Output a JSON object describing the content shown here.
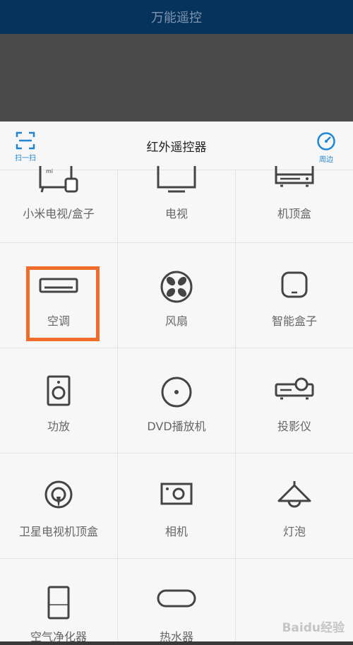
{
  "app": {
    "title": "万能遥控"
  },
  "sheet": {
    "title": "红外遥控器",
    "scan_label": "扫一扫",
    "nearby_label": "周边"
  },
  "devices": {
    "row0": [
      "小米电视/盒子",
      "电视",
      "机顶盒"
    ],
    "row1": [
      "空调",
      "风扇",
      "智能盒子"
    ],
    "row2": [
      "功放",
      "DVD播放机",
      "投影仪"
    ],
    "row3": [
      "卫星电视机顶盒",
      "相机",
      "灯泡"
    ],
    "row4": [
      "空气净化器",
      "热水器",
      ""
    ]
  },
  "watermark": "Baidu经验",
  "colors": {
    "accent": "#1f86d6",
    "highlight": "#f06c2a",
    "titlebar": "#06335c"
  },
  "icons": {
    "row0": [
      "mi-tv-box-icon",
      "tv-icon",
      "set-top-box-icon"
    ],
    "row1": [
      "air-conditioner-icon",
      "fan-icon",
      "smart-box-icon"
    ],
    "row2": [
      "amplifier-icon",
      "dvd-player-icon",
      "projector-icon"
    ],
    "row3": [
      "satellite-box-icon",
      "camera-icon",
      "light-bulb-icon"
    ],
    "row4": [
      "air-purifier-icon",
      "water-heater-icon"
    ]
  }
}
